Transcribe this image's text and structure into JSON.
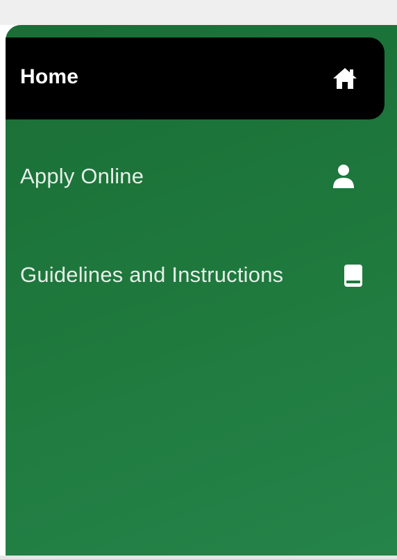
{
  "sidebar": {
    "items": [
      {
        "label": "Home",
        "icon": "home-icon",
        "active": true
      },
      {
        "label": "Apply Online",
        "icon": "user-icon",
        "active": false
      },
      {
        "label": "Guidelines and Instructions",
        "icon": "book-icon",
        "active": false
      }
    ]
  },
  "colors": {
    "sidebar_background": "#1f7a3e",
    "active_item_background": "#000000",
    "text": "#ffffff",
    "top_bar": "#efefef"
  }
}
